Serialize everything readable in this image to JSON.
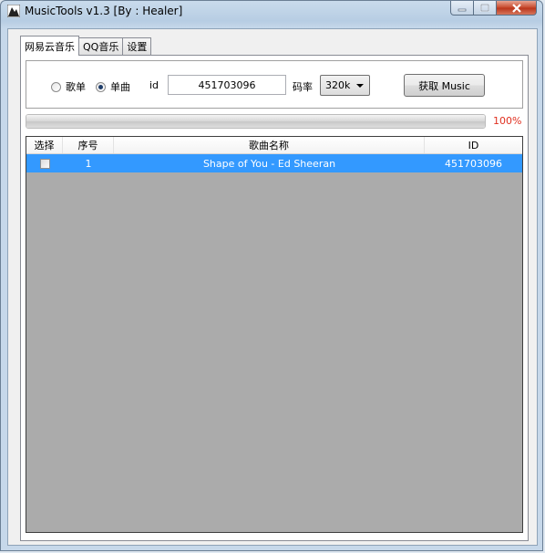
{
  "window": {
    "title": "MusicTools v1.3 [By : Healer]"
  },
  "tabs": [
    {
      "label": "网易云音乐",
      "active": true
    },
    {
      "label": "QQ音乐",
      "active": false
    },
    {
      "label": "设置",
      "active": false
    }
  ],
  "controls": {
    "radio_playlist": "歌单",
    "radio_single": "单曲",
    "selected_mode": "单曲",
    "id_label": "id",
    "id_value": "451703096",
    "rate_label": "码率",
    "rate_value": "320k",
    "fetch_button": "获取 Music"
  },
  "progress": {
    "value": 100,
    "text": "100%",
    "text_color": "#e03020"
  },
  "list": {
    "columns": [
      "选择",
      "序号",
      "歌曲名称",
      "ID"
    ],
    "rows": [
      {
        "checked": false,
        "index": "1",
        "name": "Shape of You - Ed Sheeran",
        "id": "451703096",
        "selected": true
      }
    ],
    "selection_color": "#3399ff"
  }
}
